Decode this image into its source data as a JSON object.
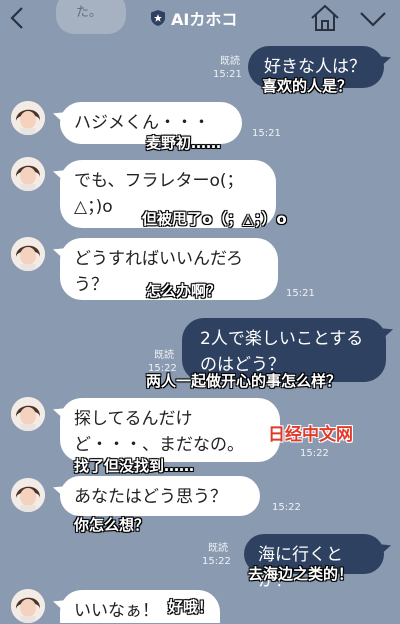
{
  "header": {
    "title": "AIカホコ",
    "prev_preview": "た。"
  },
  "messages": [
    {
      "dir": "out",
      "text": "好きな人は？",
      "read": "既読",
      "time": "15:21",
      "sub": "喜欢的人是？"
    },
    {
      "dir": "in",
      "lines": [
        "ハジメくん・・・"
      ],
      "time": "15:21",
      "sub": "麦野初……"
    },
    {
      "dir": "in",
      "lines": [
        "でも、フラレターo(；",
        "△；)o"
      ],
      "time": "",
      "sub": "但被甩了o（；△；）o"
    },
    {
      "dir": "in",
      "lines": [
        "どうすればいいんだろ",
        "う？"
      ],
      "time": "15:21",
      "sub": "怎么办啊？"
    },
    {
      "dir": "out",
      "lines": [
        "2人で楽しいことする",
        "のはどう？"
      ],
      "read": "既読",
      "time": "15:22",
      "sub": "两人一起做开心的事怎么样？"
    },
    {
      "dir": "in",
      "lines": [
        "探してるんだけ",
        "ど・・・、まだなの。"
      ],
      "time": "15:22",
      "sub": "找了但没找到……"
    },
    {
      "dir": "in",
      "lines": [
        "あなたはどう思う？"
      ],
      "time": "15:22",
      "sub": "你怎么想？"
    },
    {
      "dir": "out",
      "lines": [
        "海に行くとか！"
      ],
      "read": "既読",
      "time": "15:22",
      "sub": "去海边之类的！"
    },
    {
      "dir": "in",
      "lines": [
        "いいなぁ！"
      ],
      "time": "",
      "sub": "好哦！"
    }
  ],
  "watermark": "日经中文网",
  "colors": {
    "background": "#8a9ab0",
    "outgoing": "#2e4160",
    "incoming": "#ffffff"
  }
}
